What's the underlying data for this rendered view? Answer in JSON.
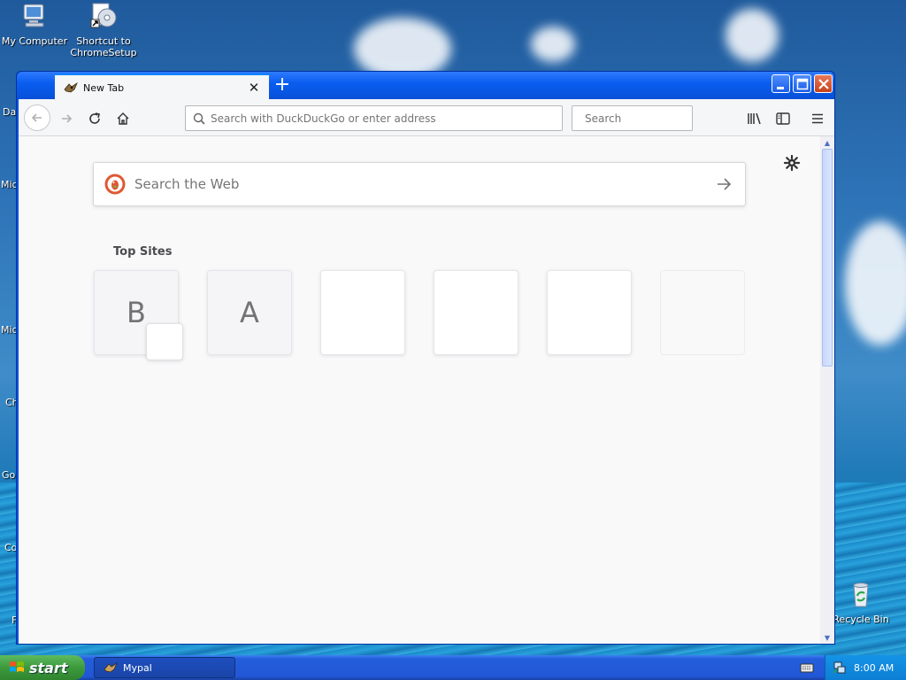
{
  "desktop": {
    "icons": [
      {
        "label": "My Computer"
      },
      {
        "label": "Shortcut to ChromeSetup"
      },
      {
        "label": "Recycle Bin"
      }
    ],
    "partial_labels": [
      "Da",
      "Mic",
      "Mic",
      "Ch",
      "Go",
      "Co",
      "F"
    ]
  },
  "browser": {
    "tab": {
      "title": "New Tab"
    },
    "toolbar": {
      "url_placeholder": "Search with DuckDuckGo or enter address",
      "search_placeholder": "Search"
    },
    "newtab_page": {
      "web_search_placeholder": "Search the Web",
      "top_sites_label": "Top Sites",
      "tiles": [
        {
          "letter": "B"
        },
        {
          "letter": "A"
        },
        {
          "letter": ""
        },
        {
          "letter": ""
        },
        {
          "letter": ""
        },
        {
          "letter": ""
        }
      ]
    }
  },
  "taskbar": {
    "start_label": "start",
    "window_button": "Mypal",
    "clock": "8:00 AM"
  },
  "colors": {
    "accent": "#0a84ff",
    "titlebar": "#0a5ef0",
    "duckduckgo": "#de5833"
  }
}
